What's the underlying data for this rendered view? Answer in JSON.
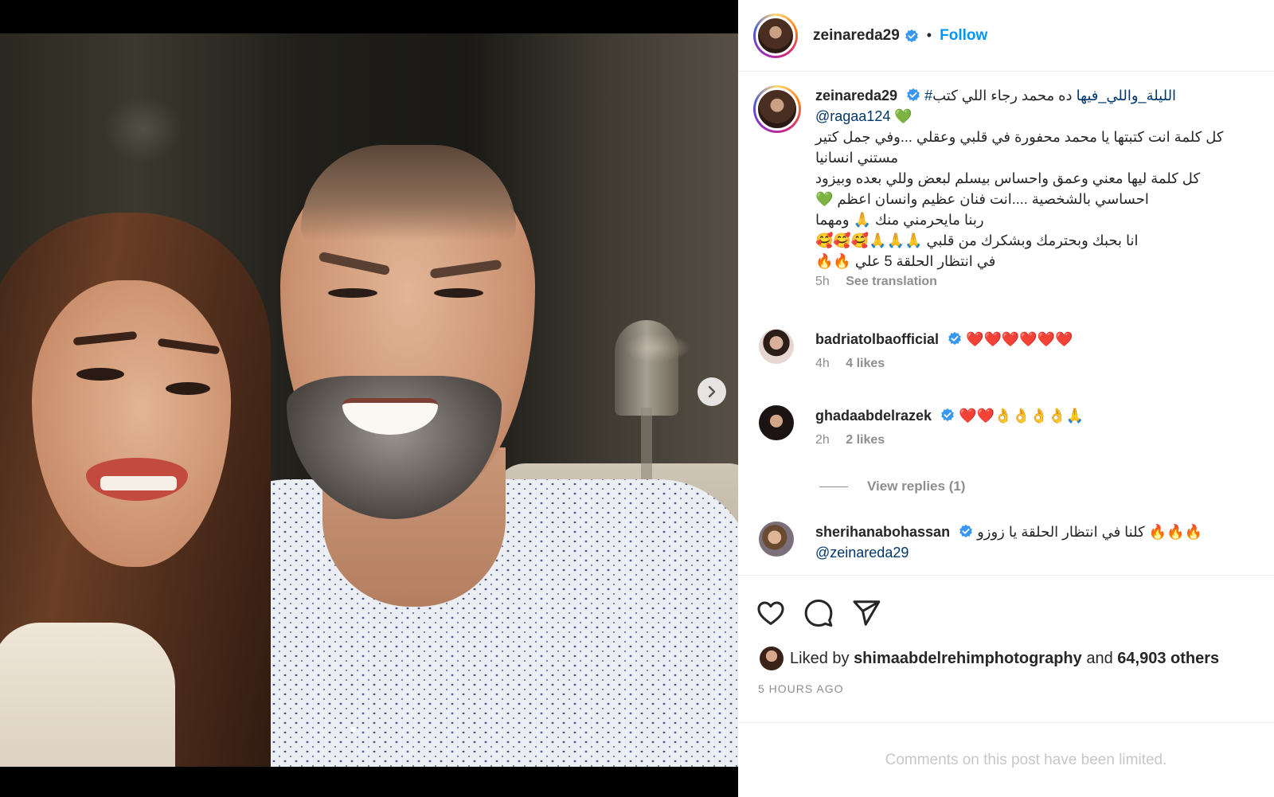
{
  "post": {
    "author": "zeinareda29",
    "follow_label": "Follow",
    "separator": "•"
  },
  "caption": {
    "user": "zeinareda29",
    "line1_text": "ده محمد رجاء اللي كتب ",
    "hashtag": "#الليلة_واللي_فيها",
    "mention": "@ragaa124",
    "mention_emoji": "💚",
    "body": [
      "كل كلمة انت كتبتها يا محمد محفورة في قلبي وعقلي ...وفي جمل كتير",
      "مستني انسانيا",
      "كل كلمة ليها معني وعمق واحساس بيسلم لبعض وللي بعده وبيزود",
      "احساسي بالشخصية ....انت فنان عظيم وانسان اعظم 💚",
      "ربنا مايحرمني منك 🙏 ومهما",
      "انا بحبك وبحترمك وبشكرك من قلبي 🙏🙏🙏🥰🥰🥰",
      "في انتظار الحلقة 5 علي 🔥🔥"
    ],
    "time": "5h",
    "see_translation": "See translation"
  },
  "comments": [
    {
      "user": "badriatolbaofficial",
      "text": "❤️❤️❤️❤️❤️❤️",
      "time": "4h",
      "likes": "4 likes"
    },
    {
      "user": "ghadaabdelrazek",
      "text": "❤️❤️👌👌👌👌🙏",
      "time": "2h",
      "likes": "2 likes"
    },
    {
      "user": "sherihanabohassan",
      "text": "🔥🔥🔥 كلنا في انتظار الحلقة يا زوزو",
      "mention": "@zeinareda29"
    }
  ],
  "view_replies": "View replies (1)",
  "liked_by": {
    "prefix": "Liked by",
    "user": "shimaabdelrehimphotography",
    "and": "and",
    "others": "64,903 others"
  },
  "timestamp": "5 HOURS AGO",
  "comments_limited": "Comments on this post have been limited.",
  "colors": {
    "link_blue": "#0095f6",
    "verified_blue": "#3897f0",
    "mention_navy": "#00376b",
    "muted_gray": "#8e8e8e"
  },
  "icons": [
    "chevron-right-icon",
    "verified-badge-icon",
    "heart-icon",
    "comment-icon",
    "share-icon"
  ]
}
